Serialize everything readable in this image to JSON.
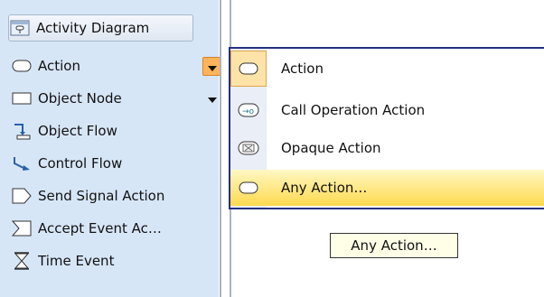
{
  "palette": {
    "header_label": "Activity Diagram",
    "items": [
      {
        "label": "Action",
        "icon": "action-oval-icon"
      },
      {
        "label": "Object Node",
        "icon": "object-node-icon"
      },
      {
        "label": "Object Flow",
        "icon": "object-flow-icon"
      },
      {
        "label": "Control Flow",
        "icon": "control-flow-icon"
      },
      {
        "label": "Send Signal Action",
        "icon": "send-signal-icon"
      },
      {
        "label": "Accept Event Ac…",
        "icon": "accept-event-icon"
      },
      {
        "label": "Time Event",
        "icon": "hourglass-icon"
      }
    ]
  },
  "popup_menu": {
    "items": [
      {
        "label": "Action",
        "icon": "action-oval-icon"
      },
      {
        "label": "Call Operation Action",
        "icon": "call-operation-icon"
      },
      {
        "label": "Opaque Action",
        "icon": "opaque-action-icon"
      },
      {
        "label": "Any Action…",
        "icon": "action-oval-icon",
        "highlighted": true
      }
    ]
  },
  "tooltip": {
    "text": "Any Action…"
  },
  "colors": {
    "palette_bg": "#d7e6f7",
    "popup_border": "#252f80",
    "highlight": "#ffd94e",
    "dropdown_active": "#ffb45c"
  }
}
